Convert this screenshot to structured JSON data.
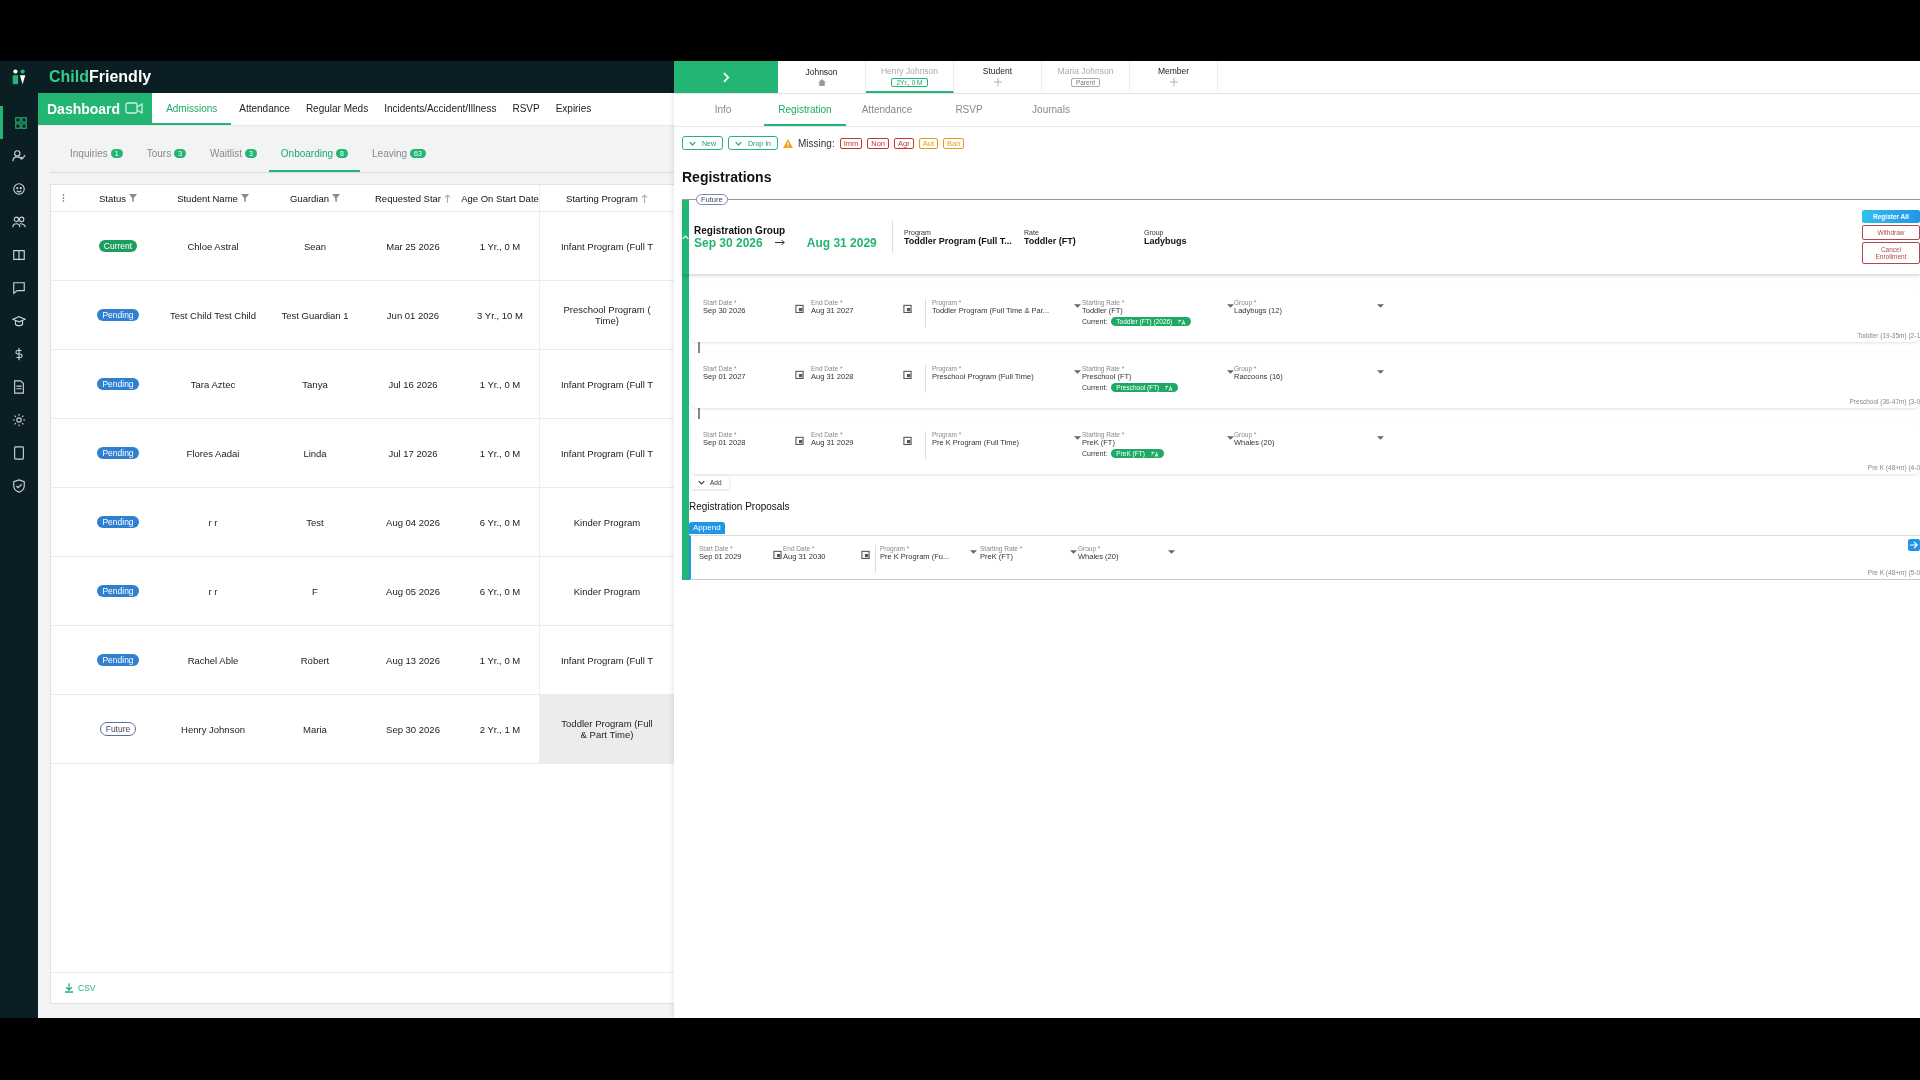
{
  "logo": {
    "first": "Child",
    "second": "Friendly"
  },
  "sidebar": {
    "items": [
      {
        "selected": true
      },
      {
        "selected": false
      },
      {
        "selected": false
      },
      {
        "selected": false
      },
      {
        "selected": false
      },
      {
        "selected": false
      },
      {
        "selected": false
      },
      {
        "selected": false
      },
      {
        "selected": false
      },
      {
        "selected": false
      },
      {
        "selected": false
      },
      {
        "selected": false
      }
    ]
  },
  "dashboard": {
    "title": "Dashboard"
  },
  "tabs": [
    {
      "label": "Admissions",
      "selected": true
    },
    {
      "label": "Attendance",
      "selected": false
    },
    {
      "label": "Regular Meds",
      "selected": false
    },
    {
      "label": "Incidents/Accident/Illness",
      "selected": false
    },
    {
      "label": "RSVP",
      "selected": false
    },
    {
      "label": "Expiries",
      "selected": false
    }
  ],
  "subtabs": [
    {
      "label": "Inquiries",
      "count": "1",
      "selected": false
    },
    {
      "label": "Tours",
      "count": "3",
      "selected": false
    },
    {
      "label": "Waitlist",
      "count": "3",
      "selected": false
    },
    {
      "label": "Onboarding",
      "count": "8",
      "selected": true
    },
    {
      "label": "Leaving",
      "count": "63",
      "selected": false
    }
  ],
  "table": {
    "columns": [
      {
        "label": "Status",
        "kind": "filterable"
      },
      {
        "label": "Student Name",
        "kind": "filterable"
      },
      {
        "label": "Guardian",
        "kind": "filterable"
      },
      {
        "label": "Requested Star",
        "kind": "sortable"
      },
      {
        "label": "Age On Start Date",
        "kind": "plain"
      },
      {
        "label": "Starting Program",
        "kind": "sortable"
      }
    ],
    "rows": [
      {
        "status": {
          "label": "Current",
          "kind": "current"
        },
        "student": "Chloe Astral",
        "guardian": "Sean",
        "requested": "Mar 25 2026",
        "age": "1 Yr., 0 M",
        "program": [
          "Infant Program (Full T"
        ],
        "selected": false
      },
      {
        "status": {
          "label": "Pending",
          "kind": "pending"
        },
        "student": "Test Child Test Child",
        "guardian": "Test Guardian 1",
        "requested": "Jun 01 2026",
        "age": "3 Yr., 10 M",
        "program": [
          "Preschool Program (",
          "Time)"
        ],
        "selected": false
      },
      {
        "status": {
          "label": "Pending",
          "kind": "pending"
        },
        "student": "Tara Aztec",
        "guardian": "Tanya",
        "requested": "Jul 16 2026",
        "age": "1 Yr., 0 M",
        "program": [
          "Infant Program (Full T"
        ],
        "selected": false
      },
      {
        "status": {
          "label": "Pending",
          "kind": "pending"
        },
        "student": "Flores Aadai",
        "guardian": "Linda",
        "requested": "Jul 17 2026",
        "age": "1 Yr., 0 M",
        "program": [
          "Infant Program (Full T"
        ],
        "selected": false
      },
      {
        "status": {
          "label": "Pending",
          "kind": "pending"
        },
        "student": "r r",
        "guardian": "Test",
        "requested": "Aug 04 2026",
        "age": "6 Yr., 0 M",
        "program": [
          "Kinder Program"
        ],
        "selected": false
      },
      {
        "status": {
          "label": "Pending",
          "kind": "pending"
        },
        "student": "r r",
        "guardian": "F",
        "requested": "Aug 05 2026",
        "age": "6 Yr., 0 M",
        "program": [
          "Kinder Program"
        ],
        "selected": false
      },
      {
        "status": {
          "label": "Pending",
          "kind": "pending"
        },
        "student": "Rachel Able",
        "guardian": "Robert",
        "requested": "Aug 13 2026",
        "age": "1 Yr., 0 M",
        "program": [
          "Infant Program (Full T"
        ],
        "selected": false
      },
      {
        "status": {
          "label": "Future",
          "kind": "future"
        },
        "student": "Henry Johnson",
        "guardian": "Maria",
        "requested": "Sep 30 2026",
        "age": "2 Yr., 1 M",
        "program": [
          "Toddler Program (Full",
          "& Part Time)"
        ],
        "selected": true
      }
    ]
  },
  "csv": {
    "label": "CSV"
  },
  "people": [
    {
      "name": "Johnson",
      "kind": "home",
      "selected": false
    },
    {
      "name": "Henry Johnson",
      "kind": "badge",
      "badge": "2Yr., 0 M",
      "selected": true
    },
    {
      "name": "Student",
      "kind": "add",
      "selected": false
    },
    {
      "name": "Maria Johnson",
      "kind": "badge",
      "badge": "Parent",
      "selected": false
    },
    {
      "name": "Member",
      "kind": "add",
      "selected": false
    }
  ],
  "detail_tabs": [
    {
      "label": "Info",
      "selected": false
    },
    {
      "label": "Registration",
      "selected": true
    },
    {
      "label": "Attendance",
      "selected": false
    },
    {
      "label": "RSVP",
      "selected": false
    },
    {
      "label": "Journals",
      "selected": false
    }
  ],
  "toolbar": {
    "new": "New",
    "drop_in": "Drop In",
    "missing_label": "Missing:",
    "missing": [
      {
        "label": "Imm",
        "color": "#c0392b"
      },
      {
        "label": "Non",
        "color": "#c0392b"
      },
      {
        "label": "Agr",
        "color": "#c0392b"
      },
      {
        "label": "Aut",
        "color": "#e59a1a"
      },
      {
        "label": "Ban",
        "color": "#e59a1a"
      }
    ]
  },
  "registrations": {
    "title": "Registrations",
    "group": {
      "status": "Future",
      "title": "Registration Group",
      "start": "Sep 30 2026",
      "end": "Aug 31 2029",
      "expanded": true,
      "summary": [
        {
          "label": "Program",
          "value": "Toddler Program (Full T..."
        },
        {
          "label": "Rate",
          "value": "Toddler (FT)"
        },
        {
          "label": "Group",
          "value": "Ladybugs"
        }
      ],
      "buttons": [
        {
          "label": "Register All",
          "kind": "primary"
        },
        {
          "label": "Withdraw",
          "kind": "danger"
        },
        {
          "label": "Cancel Enrollment",
          "kind": "danger"
        }
      ]
    },
    "rows": [
      {
        "fields": [
          {
            "label": "Start Date *",
            "value": "Sep 30 2026",
            "kind": "date"
          },
          {
            "label": "End Date *",
            "value": "Aug 31 2027",
            "kind": "date"
          },
          {
            "label": "Program *",
            "value": "Toddler Program (Full Time & Par...",
            "kind": "select"
          },
          {
            "label": "Starting Rate *",
            "value": "Toddler (FT)",
            "kind": "select",
            "current_label": "Current:",
            "current": "Toddler (FT) (2026)"
          },
          {
            "label": "Group *",
            "value": "Ladybugs (12)",
            "kind": "select"
          }
        ],
        "note": "Toddler (19-35m) (2-1"
      },
      {
        "fields": [
          {
            "label": "Start Date *",
            "value": "Sep 01 2027",
            "kind": "date"
          },
          {
            "label": "End Date *",
            "value": "Aug 31 2028",
            "kind": "date"
          },
          {
            "label": "Program *",
            "value": "Preschool Program (Full Time)",
            "kind": "select"
          },
          {
            "label": "Starting Rate *",
            "value": "Preschool (FT)",
            "kind": "select",
            "current_label": "Current:",
            "current": "Preschool (FT)"
          },
          {
            "label": "Group *",
            "value": "Raccoons (16)",
            "kind": "select"
          }
        ],
        "note": "Preschool (36-47m) (3-0"
      },
      {
        "fields": [
          {
            "label": "Start Date *",
            "value": "Sep 01 2028",
            "kind": "date"
          },
          {
            "label": "End Date *",
            "value": "Aug 31 2029",
            "kind": "date"
          },
          {
            "label": "Program *",
            "value": "Pre K Program (Full Time)",
            "kind": "select"
          },
          {
            "label": "Starting Rate *",
            "value": "PreK (FT)",
            "kind": "select",
            "current_label": "Current:",
            "current": "PreK (FT)"
          },
          {
            "label": "Group *",
            "value": "Whales (20)",
            "kind": "select"
          }
        ],
        "note": "Pre K (48+m) (4-0"
      }
    ],
    "add": "Add",
    "proposals_title": "Registration Proposals",
    "proposals": [
      {
        "tag": "Append",
        "fields": [
          {
            "label": "Start Date *",
            "value": "Sep 01 2029",
            "kind": "date"
          },
          {
            "label": "End Date *",
            "value": "Aug 31 2030",
            "kind": "date"
          },
          {
            "label": "Program *",
            "value": "Pre K Program (Fu...",
            "kind": "select"
          },
          {
            "label": "Starting Rate *",
            "value": "PreK (FT)",
            "kind": "select"
          },
          {
            "label": "Group *",
            "value": "Whales (20)",
            "kind": "select"
          }
        ],
        "note": "Pre K (48+m) (5-0"
      }
    ]
  }
}
